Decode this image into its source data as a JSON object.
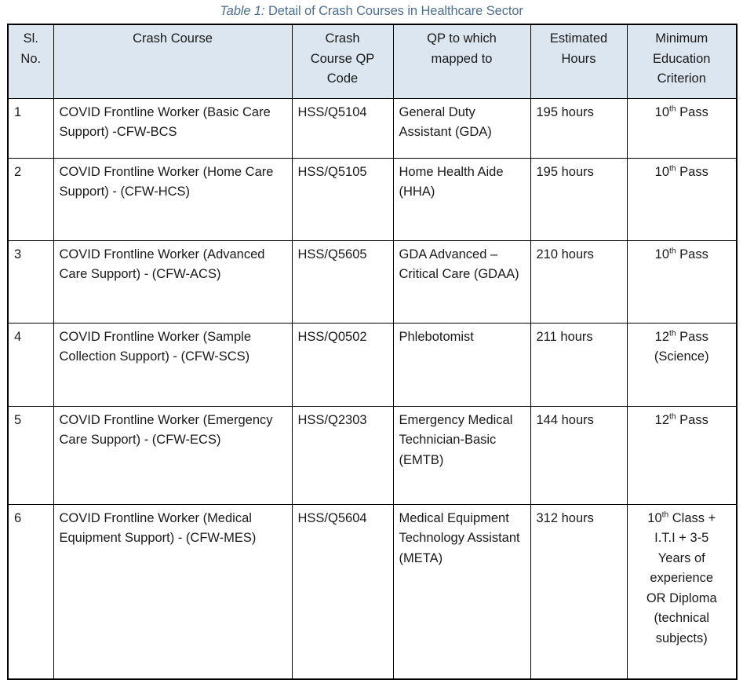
{
  "caption": {
    "label": "Table 1:",
    "text": " Detail of Crash Courses in Healthcare Sector",
    "color": "#4f6f8f"
  },
  "table": {
    "header_bg": "#dce6f1",
    "border_color": "#000000",
    "columns": [
      {
        "id": "sl",
        "lines": [
          "Sl.",
          "No."
        ]
      },
      {
        "id": "name",
        "lines": [
          "Crash Course"
        ]
      },
      {
        "id": "code",
        "lines": [
          "Crash",
          "Course QP",
          "Code"
        ]
      },
      {
        "id": "qp",
        "lines": [
          "QP to which",
          "mapped to"
        ]
      },
      {
        "id": "hours",
        "lines": [
          "Estimated",
          "Hours"
        ]
      },
      {
        "id": "edu",
        "lines": [
          "Minimum",
          "Education",
          "Criterion"
        ]
      }
    ],
    "rows": [
      {
        "sl": "1",
        "name": "COVID Frontline Worker (Basic Care Support) -CFW-BCS",
        "code": "HSS/Q5104",
        "qp": "General Duty Assistant (GDA)",
        "hours": "195 hours",
        "edu_parts": [
          {
            "text": "10"
          },
          {
            "text": "th",
            "sup": true
          },
          {
            "text": " Pass"
          }
        ]
      },
      {
        "sl": "2",
        "name": "COVID Frontline Worker (Home Care Support) - (CFW-HCS)",
        "code": "HSS/Q5105",
        "qp": "Home Health Aide (HHA)",
        "hours": "195 hours",
        "edu_parts": [
          {
            "text": "10"
          },
          {
            "text": "th",
            "sup": true
          },
          {
            "text": " Pass"
          }
        ]
      },
      {
        "sl": "3",
        "name": "COVID Frontline Worker (Advanced Care Support) - (CFW-ACS)",
        "code": "HSS/Q5605",
        "qp": "GDA Advanced – Critical Care (GDAA)",
        "hours": "210 hours",
        "edu_parts": [
          {
            "text": "10"
          },
          {
            "text": "th",
            "sup": true
          },
          {
            "text": " Pass"
          }
        ]
      },
      {
        "sl": "4",
        "name": "COVID Frontline Worker (Sample Collection Support) - (CFW-SCS)",
        "code": "HSS/Q0502",
        "qp": "Phlebotomist",
        "hours": "211 hours",
        "edu_parts": [
          {
            "text": "12"
          },
          {
            "text": "th",
            "sup": true
          },
          {
            "text": " Pass"
          },
          {
            "text": "(Science)",
            "newline": true
          }
        ]
      },
      {
        "sl": "5",
        "name": "COVID Frontline Worker (Emergency Care Support) - (CFW-ECS)",
        "code": "HSS/Q2303",
        "qp": "Emergency Medical Technician-Basic (EMTB)",
        "hours": "144 hours",
        "edu_parts": [
          {
            "text": "12"
          },
          {
            "text": "th",
            "sup": true
          },
          {
            "text": " Pass"
          }
        ]
      },
      {
        "sl": "6",
        "name": "COVID Frontline Worker (Medical Equipment Support) - (CFW-MES)",
        "code": "HSS/Q5604",
        "qp": "Medical Equipment Technology Assistant (META)",
        "hours": "312 hours",
        "edu_parts": [
          {
            "text": "10"
          },
          {
            "text": "th",
            "sup": true
          },
          {
            "text": " Class +"
          },
          {
            "text": "I.T.I + 3-5",
            "newline": true
          },
          {
            "text": "Years of",
            "newline": true
          },
          {
            "text": "experience",
            "newline": true
          },
          {
            "text": "OR Diploma",
            "newline": true
          },
          {
            "text": "(technical",
            "newline": true
          },
          {
            "text": "subjects)",
            "newline": true
          }
        ]
      }
    ]
  }
}
